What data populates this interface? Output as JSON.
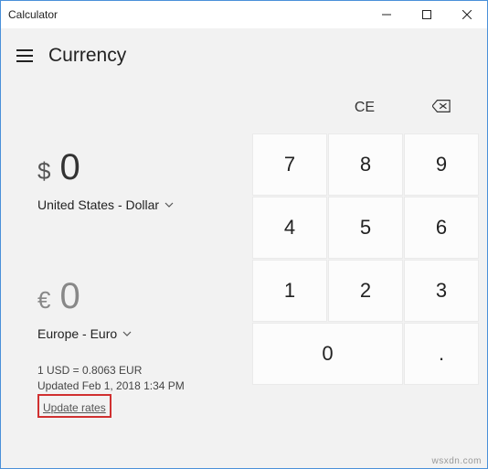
{
  "window": {
    "title": "Calculator"
  },
  "header": {
    "mode": "Currency"
  },
  "from": {
    "symbol": "$",
    "value": "0",
    "label": "United States - Dollar"
  },
  "to": {
    "symbol": "€",
    "value": "0",
    "label": "Europe - Euro"
  },
  "rate": {
    "line": "1 USD = 0.8063 EUR",
    "updated": "Updated Feb 1, 2018 1:34 PM",
    "link": "Update rates"
  },
  "keypad": {
    "ce": "CE",
    "keys": [
      "7",
      "8",
      "9",
      "4",
      "5",
      "6",
      "1",
      "2",
      "3",
      "0",
      "."
    ]
  },
  "watermark": "wsxdn.com"
}
